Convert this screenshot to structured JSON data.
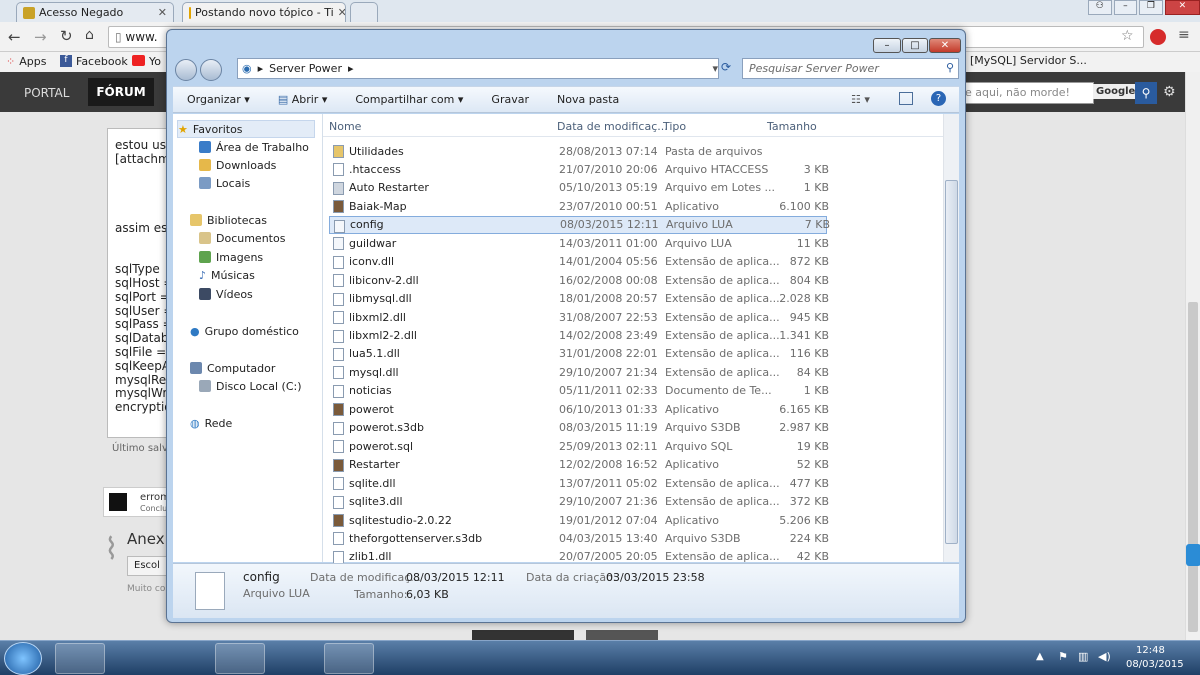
{
  "browser": {
    "tabs": [
      {
        "label": "Acesso Negado"
      },
      {
        "label": "Postando novo tópico - Ti"
      }
    ],
    "address": "www.",
    "bookmarks": [
      "Apps",
      "Facebook",
      "Yo"
    ],
    "right_tab_text": "[MySQL] Servidor S..."
  },
  "site": {
    "nav": [
      "PORTAL",
      "FÓRUM"
    ],
    "search_placeholder": "e aqui, não morde!",
    "google_label": "Google"
  },
  "editor": {
    "lines": [
      "estou usa",
      "[attachme",
      "",
      "",
      "",
      "",
      "assim es",
      "",
      "",
      "sqlType",
      "sqlHost =",
      "sqlPort =",
      "sqlUser =",
      "sqlPass =",
      "sqlDatab",
      "sqlFile =",
      "sqlKeepA",
      "mysqlRea",
      "mysqlWri",
      "encryptio"
    ],
    "saved_text": "Último salva",
    "error_title": "errom",
    "error_sub": "Conclu",
    "attach_title": "Anex",
    "choose_btn": "Escol",
    "hint": "Muito co"
  },
  "explorer": {
    "path": "Server Power",
    "search_placeholder": "Pesquisar Server Power",
    "commands": [
      "Organizar",
      "Abrir",
      "Compartilhar com",
      "Gravar",
      "Nova pasta"
    ],
    "nav": {
      "favorites": "Favoritos",
      "favorites_items": [
        "Área de Trabalho",
        "Downloads",
        "Locais"
      ],
      "libraries": "Bibliotecas",
      "library_items": [
        "Documentos",
        "Imagens",
        "Músicas",
        "Vídeos"
      ],
      "homegroup": "Grupo doméstico",
      "computer": "Computador",
      "computer_items": [
        "Disco Local (C:)"
      ],
      "network": "Rede"
    },
    "columns": [
      "Nome",
      "Data de modificaç...",
      "Tipo",
      "Tamanho"
    ],
    "files": [
      {
        "name": "Utilidades",
        "date": "28/08/2013 07:14",
        "type": "Pasta de arquivos",
        "size": ""
      },
      {
        "name": ".htaccess",
        "date": "21/07/2010 20:06",
        "type": "Arquivo HTACCESS",
        "size": "3 KB"
      },
      {
        "name": "Auto Restarter",
        "date": "05/10/2013 05:19",
        "type": "Arquivo em Lotes ...",
        "size": "1 KB"
      },
      {
        "name": "Baiak-Map",
        "date": "23/07/2010 00:51",
        "type": "Aplicativo",
        "size": "6.100 KB"
      },
      {
        "name": "config",
        "date": "08/03/2015 12:11",
        "type": "Arquivo LUA",
        "size": "7 KB"
      },
      {
        "name": "guildwar",
        "date": "14/03/2011 01:00",
        "type": "Arquivo LUA",
        "size": "11 KB"
      },
      {
        "name": "iconv.dll",
        "date": "14/01/2004 05:56",
        "type": "Extensão de aplica...",
        "size": "872 KB"
      },
      {
        "name": "libiconv-2.dll",
        "date": "16/02/2008 00:08",
        "type": "Extensão de aplica...",
        "size": "804 KB"
      },
      {
        "name": "libmysql.dll",
        "date": "18/01/2008 20:57",
        "type": "Extensão de aplica...",
        "size": "2.028 KB"
      },
      {
        "name": "libxml2.dll",
        "date": "31/08/2007 22:53",
        "type": "Extensão de aplica...",
        "size": "945 KB"
      },
      {
        "name": "libxml2-2.dll",
        "date": "14/02/2008 23:49",
        "type": "Extensão de aplica...",
        "size": "1.341 KB"
      },
      {
        "name": "lua5.1.dll",
        "date": "31/01/2008 22:01",
        "type": "Extensão de aplica...",
        "size": "116 KB"
      },
      {
        "name": "mysql.dll",
        "date": "29/10/2007 21:34",
        "type": "Extensão de aplica...",
        "size": "84 KB"
      },
      {
        "name": "noticias",
        "date": "05/11/2011 02:33",
        "type": "Documento de Te...",
        "size": "1 KB"
      },
      {
        "name": "powerot",
        "date": "06/10/2013 01:33",
        "type": "Aplicativo",
        "size": "6.165 KB"
      },
      {
        "name": "powerot.s3db",
        "date": "08/03/2015 11:19",
        "type": "Arquivo S3DB",
        "size": "2.987 KB"
      },
      {
        "name": "powerot.sql",
        "date": "25/09/2013 02:11",
        "type": "Arquivo SQL",
        "size": "19 KB"
      },
      {
        "name": "Restarter",
        "date": "12/02/2008 16:52",
        "type": "Aplicativo",
        "size": "52 KB"
      },
      {
        "name": "sqlite.dll",
        "date": "13/07/2011 05:02",
        "type": "Extensão de aplica...",
        "size": "477 KB"
      },
      {
        "name": "sqlite3.dll",
        "date": "29/10/2007 21:36",
        "type": "Extensão de aplica...",
        "size": "372 KB"
      },
      {
        "name": "sqlitestudio-2.0.22",
        "date": "19/01/2012 07:04",
        "type": "Aplicativo",
        "size": "5.206 KB"
      },
      {
        "name": "theforgottenserver.s3db",
        "date": "04/03/2015 13:40",
        "type": "Arquivo S3DB",
        "size": "224 KB"
      },
      {
        "name": "zlib1.dll",
        "date": "20/07/2005 20:05",
        "type": "Extensão de aplica...",
        "size": "42 KB"
      }
    ],
    "details": {
      "name": "config",
      "type": "Arquivo LUA",
      "modified_label": "Data de modificaç...",
      "modified": "08/03/2015 12:11",
      "created_label": "Data da criação:",
      "created": "03/03/2015 23:58",
      "size_label": "Tamanho:",
      "size": "6,03 KB"
    }
  },
  "taskbar": {
    "time": "12:48",
    "date": "08/03/2015"
  }
}
